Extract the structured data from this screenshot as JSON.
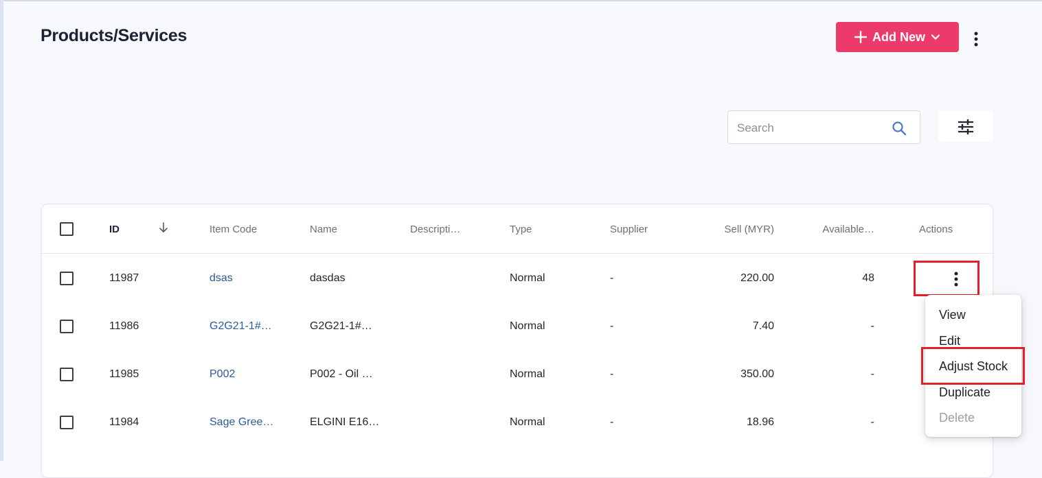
{
  "page": {
    "title": "Products/Services",
    "add_new_label": "Add New"
  },
  "search": {
    "placeholder": "Search",
    "value": ""
  },
  "table": {
    "columns": {
      "id": "ID",
      "item_code": "Item Code",
      "name": "Name",
      "description": "Descripti…",
      "type": "Type",
      "supplier": "Supplier",
      "sell": "Sell (MYR)",
      "available": "Available…",
      "actions": "Actions"
    },
    "rows": [
      {
        "id": "11987",
        "item_code": "dsas",
        "name": "dasdas",
        "description": "",
        "type": "Normal",
        "supplier": "-",
        "sell": "220.00",
        "available": "48"
      },
      {
        "id": "11986",
        "item_code": "G2G21-1#…",
        "name": "G2G21-1#…",
        "description": "",
        "type": "Normal",
        "supplier": "-",
        "sell": "7.40",
        "available": "-"
      },
      {
        "id": "11985",
        "item_code": "P002",
        "name": "P002 - Oil …",
        "description": "",
        "type": "Normal",
        "supplier": "-",
        "sell": "350.00",
        "available": "-"
      },
      {
        "id": "11984",
        "item_code": "Sage Gree…",
        "name": "ELGINI E16…",
        "description": "",
        "type": "Normal",
        "supplier": "-",
        "sell": "18.96",
        "available": "-"
      }
    ]
  },
  "row_menu": {
    "items": [
      {
        "label": "View",
        "disabled": false
      },
      {
        "label": "Edit",
        "disabled": false
      },
      {
        "label": "Adjust Stock",
        "disabled": false
      },
      {
        "label": "Duplicate",
        "disabled": false
      },
      {
        "label": "Delete",
        "disabled": true
      }
    ]
  },
  "colors": {
    "accent": "#ec3b6a",
    "link": "#2a5c9a",
    "highlight": "#e41e2b"
  },
  "icons": {
    "add": "plus-icon",
    "dropdown": "chevron-down-icon",
    "more": "more-vertical-icon",
    "search": "search-icon",
    "filter": "sliders-icon",
    "sort": "arrow-down-icon"
  }
}
